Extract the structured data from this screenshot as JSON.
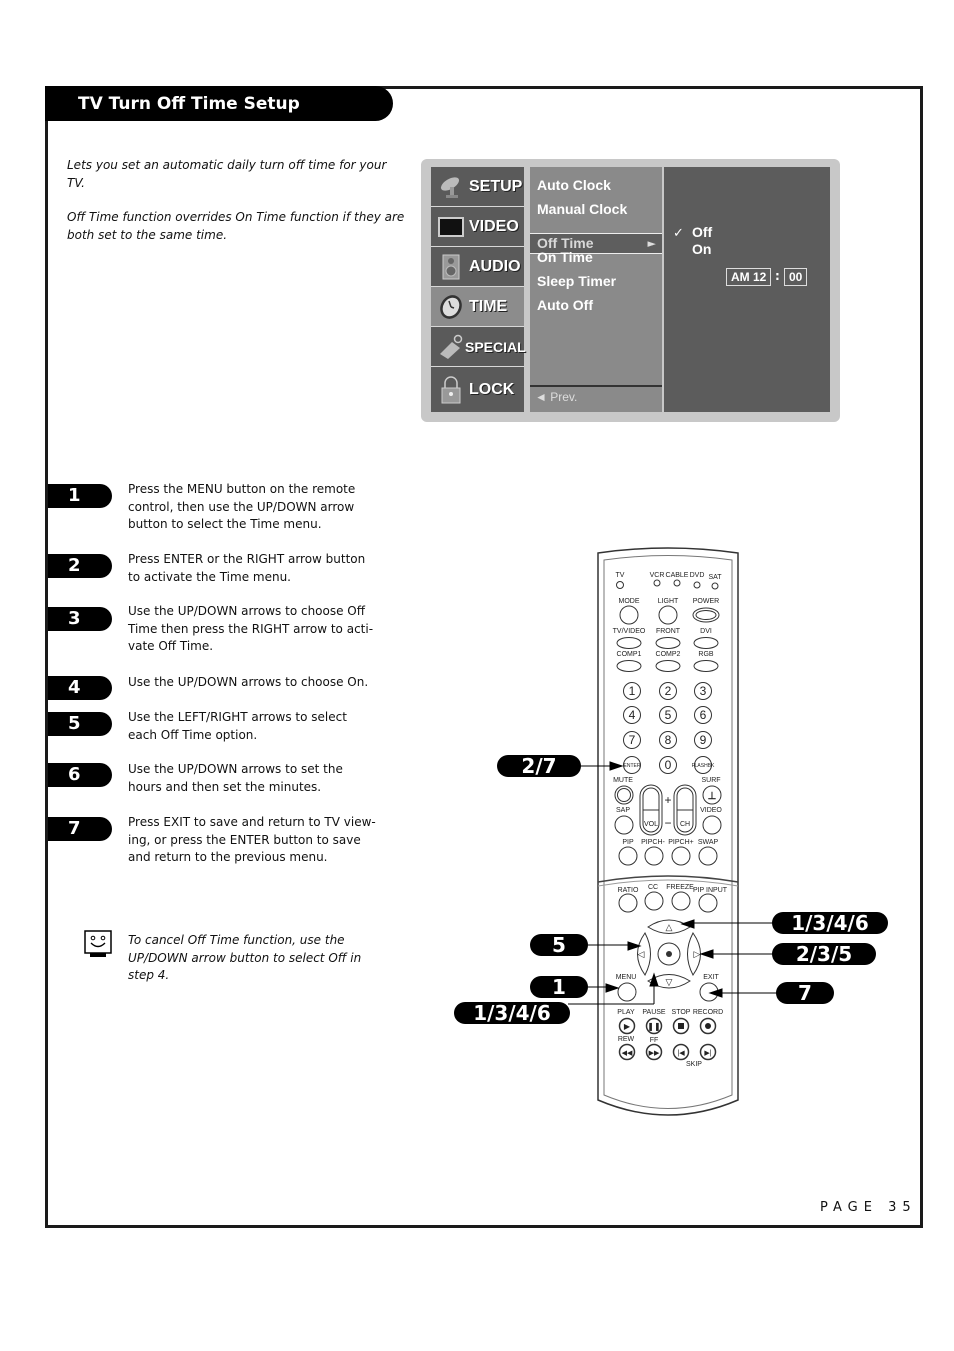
{
  "section_title": "TV Turn Off Time Setup",
  "intro": [
    "Lets you set an automatic daily turn off time for your TV.",
    "Off Time function overrides On Time function if they are both set to the same time."
  ],
  "osd": {
    "main_menu": [
      {
        "label": "SETUP",
        "icon": "satellite-dish-icon"
      },
      {
        "label": "VIDEO",
        "icon": "screen-icon"
      },
      {
        "label": "AUDIO",
        "icon": "speaker-icon"
      },
      {
        "label": "TIME",
        "icon": "clock-icon",
        "active": true
      },
      {
        "label": "SPECIAL",
        "icon": "tag-icon"
      },
      {
        "label": "LOCK",
        "icon": "padlock-icon"
      }
    ],
    "submenu": [
      "Auto Clock",
      "Manual Clock",
      "Off Time",
      "On Time",
      "Sleep Timer",
      "Auto Off"
    ],
    "selected_submenu": "Off Time",
    "submenu_arrow": "►",
    "prev_label": "◄ Prev.",
    "options": [
      "Off",
      "On"
    ],
    "checked_option": "Off",
    "check_mark": "✓",
    "time": {
      "ampm_hour": "AM 12",
      "separator": ":",
      "minutes": "00"
    }
  },
  "steps": [
    {
      "num": "1",
      "text": "Press the MENU button on the remote control, then use the UP/DOWN arrow button to select the Time menu."
    },
    {
      "num": "2",
      "text": "Press ENTER or the RIGHT arrow button to activate the Time menu."
    },
    {
      "num": "3",
      "text": "Use the UP/DOWN arrows to choose Off Time then press the RIGHT arrow to acti-vate Off Time."
    },
    {
      "num": "4",
      "text": "Use the UP/DOWN arrows to choose On."
    },
    {
      "num": "5",
      "text": "Use the LEFT/RIGHT arrows to select each Off Time option."
    },
    {
      "num": "6",
      "text": "Use the UP/DOWN arrows to set the hours and then set the minutes."
    },
    {
      "num": "7",
      "text": "Press EXIT to save and return to TV view-ing, or press the ENTER button to save and return to the previous menu."
    }
  ],
  "tip": "To cancel Off Time function, use the UP/DOWN arrow button to select Off in step 4.",
  "callouts": {
    "enter": "2/7",
    "up": "1/3/4/6",
    "right": "2/3/5",
    "exit": "7",
    "left": "5",
    "menu": "1",
    "down": "1/3/4/6"
  },
  "remote": {
    "modes": [
      "TV",
      "VCR",
      "CABLE",
      "DVD",
      "SAT"
    ],
    "row_mode": [
      "MODE",
      "LIGHT",
      "POWER"
    ],
    "row_input1": [
      "TV/VIDEO",
      "FRONT",
      "DVI"
    ],
    "row_input2": [
      "COMP1",
      "COMP2",
      "RGB"
    ],
    "digits": [
      "1",
      "2",
      "3",
      "4",
      "5",
      "6",
      "7",
      "8",
      "9",
      "ENTER",
      "0",
      "FLASHBK"
    ],
    "mute": "MUTE",
    "surf": "SURF",
    "sap": "SAP",
    "video": "VIDEO",
    "vol": "VOL",
    "ch": "CH",
    "plus": "+",
    "minus": "−",
    "row_pip": [
      "PIP",
      "PIPCH-",
      "PIPCH+",
      "SWAP"
    ],
    "row_ratio": [
      "RATIO",
      "CC",
      "FREEZE",
      "PIP INPUT"
    ],
    "menu": "MENU",
    "exit": "EXIT",
    "row_play": [
      "PLAY",
      "PAUSE",
      "STOP",
      "RECORD"
    ],
    "rew": "REW",
    "ff": "FF",
    "skip": "SKIP"
  },
  "page_number": "PAGE 35"
}
